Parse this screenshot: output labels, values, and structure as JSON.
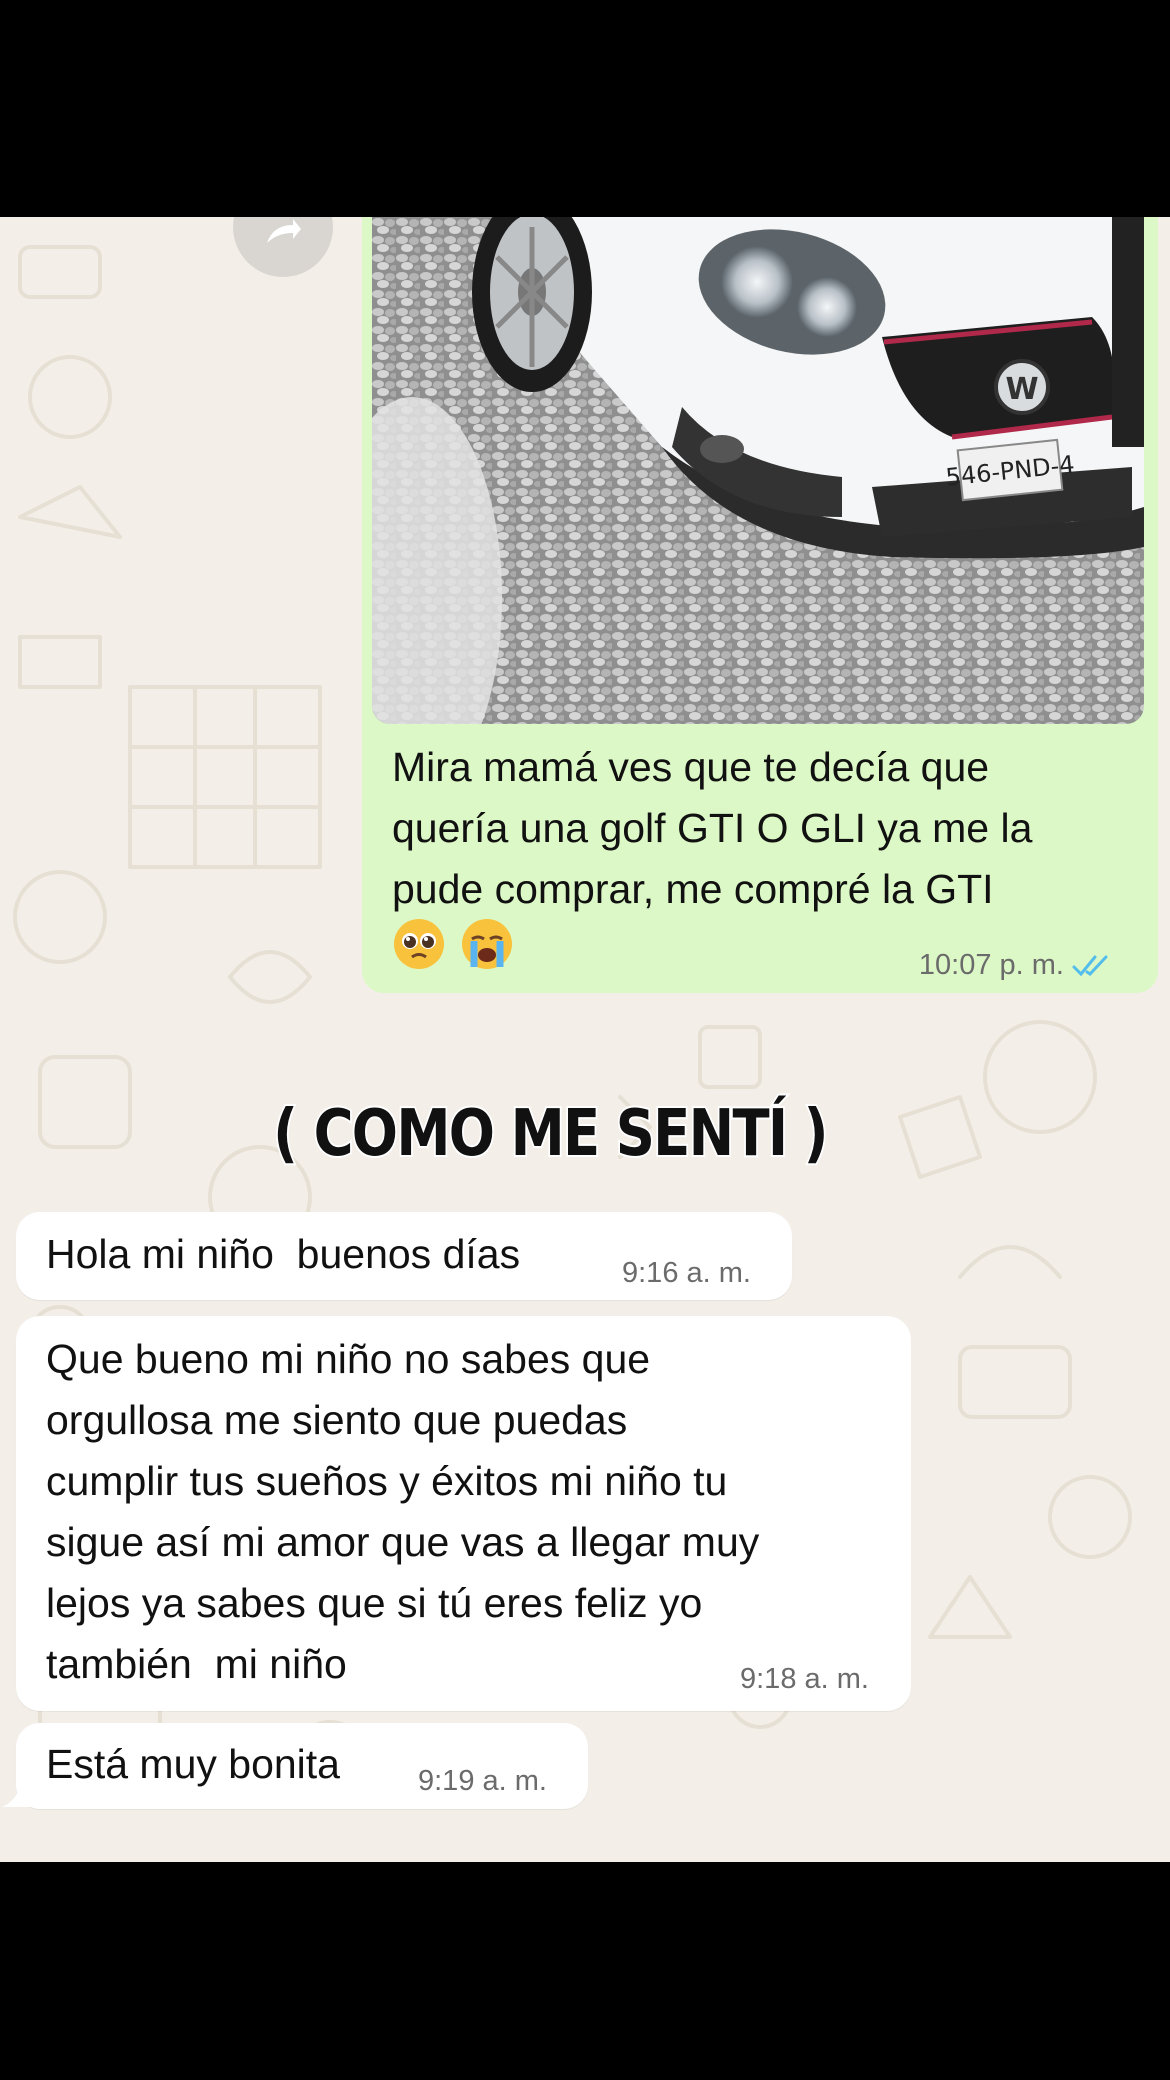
{
  "outgoing": {
    "text": "Mira mamá ves que te decía que\nquería una golf GTI O GLI ya me la\npude comprar, me compré la GTI",
    "emojis": [
      "🥺",
      "😭"
    ],
    "time": "10:07 p. m.",
    "status_icon": "double-check-icon",
    "image": {
      "license_plate": "546-PND-4"
    }
  },
  "caption": "( COMO ME SENTÍ )",
  "incoming": [
    {
      "text": "Hola mi niño  buenos días",
      "time": "9:16 a. m."
    },
    {
      "text": "Que bueno mi niño no sabes que\norgullosa me siento que puedas\ncumplir tus sueños y éxitos mi niño tu\nsigue así mi amor que vas a llegar muy\nlejos ya sabes que si tú eres feliz yo\ntambién  mi niño",
      "time": "9:18 a. m."
    },
    {
      "text": "Está muy bonita",
      "time": "9:19 a. m."
    }
  ],
  "colors": {
    "outgoing_bubble": "#dcf8c6",
    "incoming_bubble": "#ffffff",
    "chat_background": "#f3efe8",
    "read_check": "#53bdeb"
  }
}
